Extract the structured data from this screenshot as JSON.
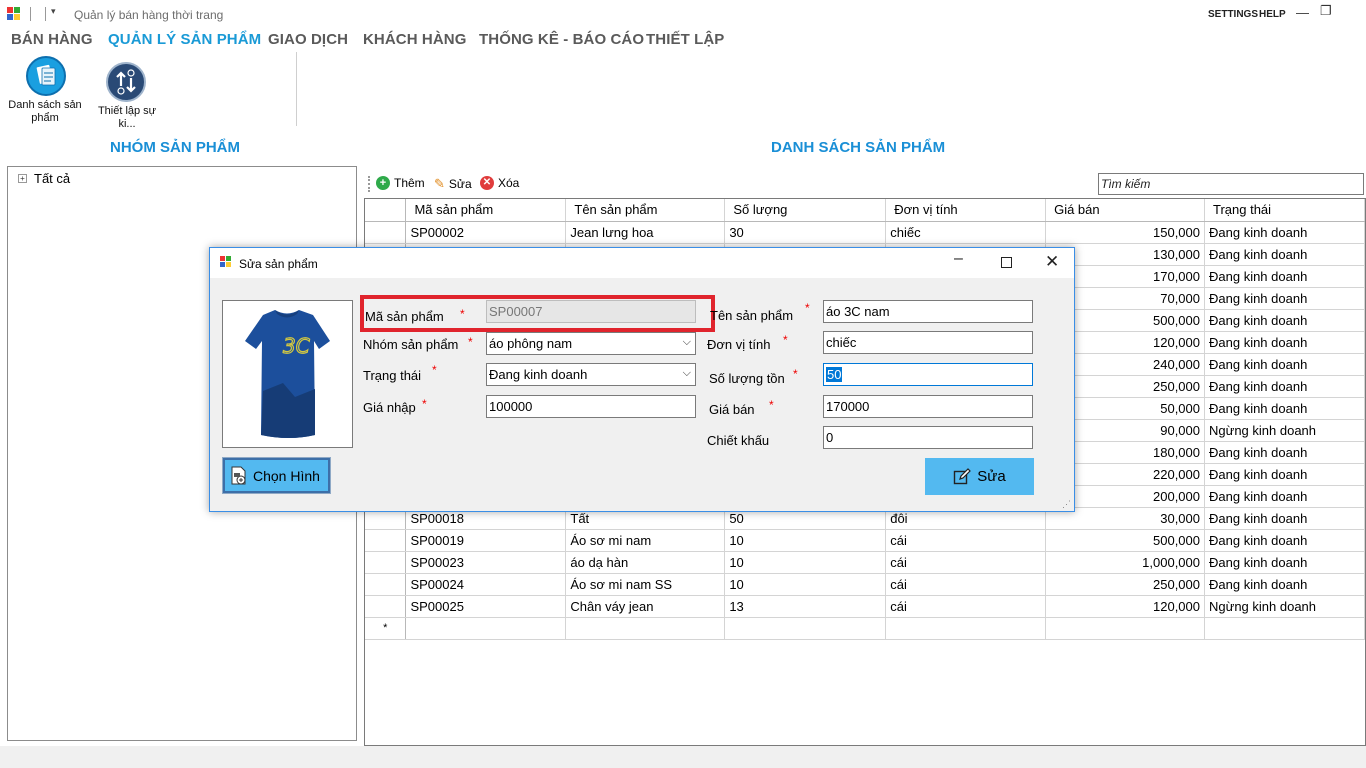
{
  "titlebar": {
    "title": "Quản lý bán hàng thời trang",
    "settings": "SETTINGS",
    "help": "HELP",
    "minimize": "—",
    "restore": "❐"
  },
  "menu": {
    "tabs": [
      "BÁN HÀNG",
      "QUẢN LÝ SẢN PHẨM",
      "GIAO DỊCH",
      "KHÁCH HÀNG",
      "THỐNG KÊ - BÁO CÁO",
      "THIẾT LẬP"
    ],
    "active_index": 1
  },
  "ribbon": {
    "product_list": "Danh sách sản phẩm",
    "setup_event": "Thiết lập sự ki..."
  },
  "left_panel": {
    "title": "NHÓM SẢN PHẨM",
    "tree_root": "Tất cả"
  },
  "main": {
    "title": "DANH SÁCH SẢN PHẨM",
    "toolbar": {
      "add": "Thêm",
      "edit": "Sửa",
      "delete": "Xóa"
    },
    "search_placeholder": "Tìm kiếm",
    "columns": [
      "Mã sản phẩm",
      "Tên sản phẩm",
      "Số lượng",
      "Đơn vị tính",
      "Giá bán",
      "Trạng thái"
    ],
    "rows": [
      [
        "SP00002",
        "Jean lưng hoa",
        "30",
        "chiếc",
        "150,000",
        "Đang kinh doanh"
      ],
      [
        "",
        "",
        "",
        "",
        "130,000",
        "Đang kinh doanh"
      ],
      [
        "",
        "",
        "",
        "",
        "170,000",
        "Đang kinh doanh"
      ],
      [
        "",
        "",
        "",
        "",
        "70,000",
        "Đang kinh doanh"
      ],
      [
        "",
        "",
        "",
        "",
        "500,000",
        "Đang kinh doanh"
      ],
      [
        "",
        "",
        "",
        "",
        "120,000",
        "Đang kinh doanh"
      ],
      [
        "",
        "",
        "",
        "",
        "240,000",
        "Đang kinh doanh"
      ],
      [
        "",
        "",
        "",
        "",
        "250,000",
        "Đang kinh doanh"
      ],
      [
        "",
        "",
        "",
        "",
        "50,000",
        "Đang kinh doanh"
      ],
      [
        "",
        "",
        "",
        "",
        "90,000",
        "Ngừng kinh doanh"
      ],
      [
        "",
        "",
        "",
        "",
        "180,000",
        "Đang kinh doanh"
      ],
      [
        "",
        "",
        "",
        "",
        "220,000",
        "Đang kinh doanh"
      ],
      [
        "",
        "",
        "",
        "",
        "200,000",
        "Đang kinh doanh"
      ],
      [
        "SP00018",
        "Tất",
        "50",
        "đôi",
        "30,000",
        "Đang kinh doanh"
      ],
      [
        "SP00019",
        "Áo sơ mi nam",
        "10",
        "cái",
        "500,000",
        "Đang kinh doanh"
      ],
      [
        "SP00023",
        "áo dạ hàn",
        "10",
        "cái",
        "1,000,000",
        "Đang kinh doanh"
      ],
      [
        "SP00024",
        "Áo sơ mi nam SS",
        "10",
        "cái",
        "250,000",
        "Đang kinh doanh"
      ],
      [
        "SP00025",
        "Chân váy jean",
        "13",
        "cái",
        "120,000",
        "Ngừng kinh doanh"
      ]
    ],
    "new_row_marker": "*"
  },
  "dialog": {
    "title": "Sửa sản phẩm",
    "choose_image": "Chọn Hình",
    "labels": {
      "code": "Mã sản phẩm",
      "group": "Nhóm sản phẩm",
      "status": "Trạng thái",
      "import_price": "Giá nhập",
      "name": "Tên sản phẩm",
      "unit": "Đơn vị tính",
      "quantity": "Số lượng tồn",
      "sale_price": "Giá bán",
      "discount": "Chiết khấu"
    },
    "required_mark": "*",
    "values": {
      "code": "SP00007",
      "group": "áo phông nam",
      "status": "Đang kinh doanh",
      "import_price": "100000",
      "name": "áo 3C nam",
      "unit": "chiếc",
      "quantity": "50",
      "sale_price": "170000",
      "discount": "0"
    },
    "save": "Sửa",
    "shirt_print": "3C"
  },
  "colors": {
    "accent": "#1a9ad6",
    "button_blue": "#53b9f0",
    "highlight_red": "#e0242d",
    "shirt_blue": "#1c4f9c"
  }
}
